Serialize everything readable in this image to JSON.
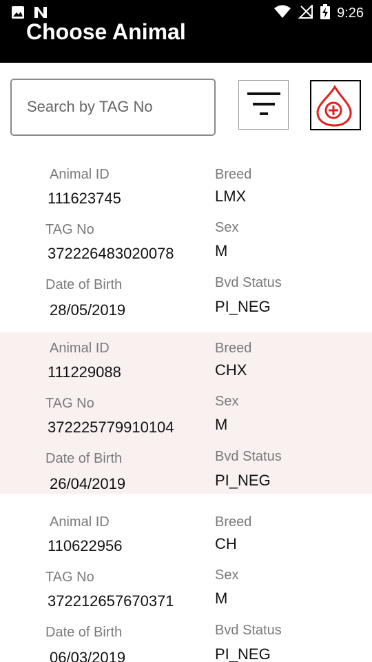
{
  "status_bar": {
    "time": "9:26"
  },
  "app_bar": {
    "title": "Choose Animal"
  },
  "search": {
    "placeholder": "Search by TAG No",
    "value": ""
  },
  "labels": {
    "animal_id": "Animal ID",
    "tag_no": "TAG No",
    "dob": "Date of Birth",
    "breed": "Breed",
    "sex": "Sex",
    "bvd_status": "Bvd Status"
  },
  "animals": [
    {
      "animal_id": "111623745",
      "tag_no": "372226483020078",
      "dob": "28/05/2019",
      "breed": "LMX",
      "sex": "M",
      "bvd_status": "PI_NEG"
    },
    {
      "animal_id": "111229088",
      "tag_no": "372225779910104",
      "dob": "26/04/2019",
      "breed": "CHX",
      "sex": "M",
      "bvd_status": "PI_NEG"
    },
    {
      "animal_id": "110622956",
      "tag_no": "372212657670371",
      "dob": "06/03/2019",
      "breed": "CH",
      "sex": "M",
      "bvd_status": "PI_NEG"
    }
  ],
  "icons": {
    "status_left": [
      "image-icon",
      "n-notification-icon"
    ],
    "status_right": [
      "wifi-icon",
      "no-signal-icon",
      "battery-charging-icon"
    ],
    "filter": "filter-icon",
    "blood_add": "blood-drop-add-icon"
  },
  "colors": {
    "appbar": "#000000",
    "accent": "#e02020",
    "alt_row": "#f8f1f0"
  }
}
